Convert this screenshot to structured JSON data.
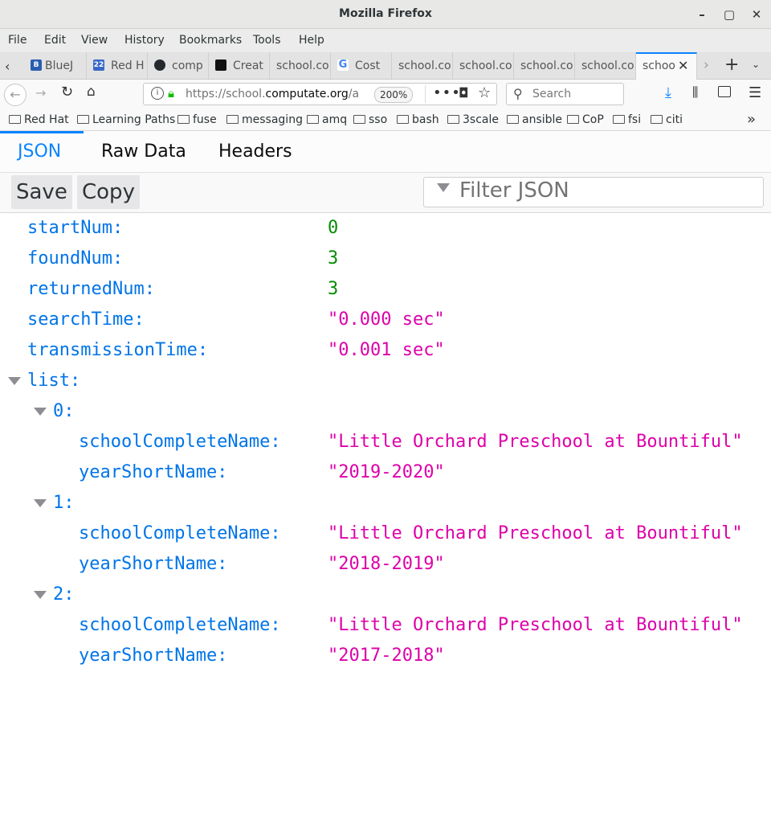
{
  "window": {
    "title": "Mozilla Firefox"
  },
  "menu": [
    "File",
    "Edit",
    "View",
    "History",
    "Bookmarks",
    "Tools",
    "Help"
  ],
  "tabs": [
    {
      "label": "BlueJ",
      "favicon": "B"
    },
    {
      "label": "Red H",
      "favicon": "22"
    },
    {
      "label": "comp"
    },
    {
      "label": "Creat"
    },
    {
      "label": "school.co"
    },
    {
      "label": "Cost"
    },
    {
      "label": "school.co"
    },
    {
      "label": "school.co"
    },
    {
      "label": "school.co"
    },
    {
      "label": "school.co"
    },
    {
      "label": "schoo",
      "active": true
    }
  ],
  "nav": {
    "url_prefix": "https://school.",
    "url_domain": "computate.org",
    "url_suffix": "/a",
    "zoom": "200%",
    "search_placeholder": "Search"
  },
  "bookmarks": [
    "Red Hat",
    "Learning Paths",
    "fuse",
    "messaging",
    "amq",
    "sso",
    "bash",
    "3scale",
    "ansible",
    "CoP",
    "fsi",
    "citi"
  ],
  "viewer": {
    "tabs": [
      "JSON",
      "Raw Data",
      "Headers"
    ],
    "save_label": "Save",
    "copy_label": "Copy",
    "filter_placeholder": "Filter JSON"
  },
  "json_rows": {
    "startNum": {
      "key": "startNum:",
      "value": "0"
    },
    "foundNum": {
      "key": "foundNum:",
      "value": "3"
    },
    "returnedNum": {
      "key": "returnedNum:",
      "value": "3"
    },
    "searchTime": {
      "key": "searchTime:",
      "value": "\"0.000 sec\""
    },
    "transmissionTime": {
      "key": "transmissionTime:",
      "value": "\"0.001 sec\""
    },
    "list": {
      "key": "list:"
    },
    "items": [
      {
        "index": "0:",
        "name_key": "schoolCompleteName:",
        "name_value": "\"Little Orchard Preschool at Bountiful\"",
        "year_key": "yearShortName:",
        "year_value": "\"2019-2020\""
      },
      {
        "index": "1:",
        "name_key": "schoolCompleteName:",
        "name_value": "\"Little Orchard Preschool at Bountiful\"",
        "year_key": "yearShortName:",
        "year_value": "\"2018-2019\""
      },
      {
        "index": "2:",
        "name_key": "schoolCompleteName:",
        "name_value": "\"Little Orchard Preschool at Bountiful\"",
        "year_key": "yearShortName:",
        "year_value": "\"2017-2018\""
      }
    ]
  },
  "colors": {
    "accent": "#0a84ff",
    "key": "#0074e8",
    "number": "#058b00",
    "string": "#dd00a9"
  }
}
